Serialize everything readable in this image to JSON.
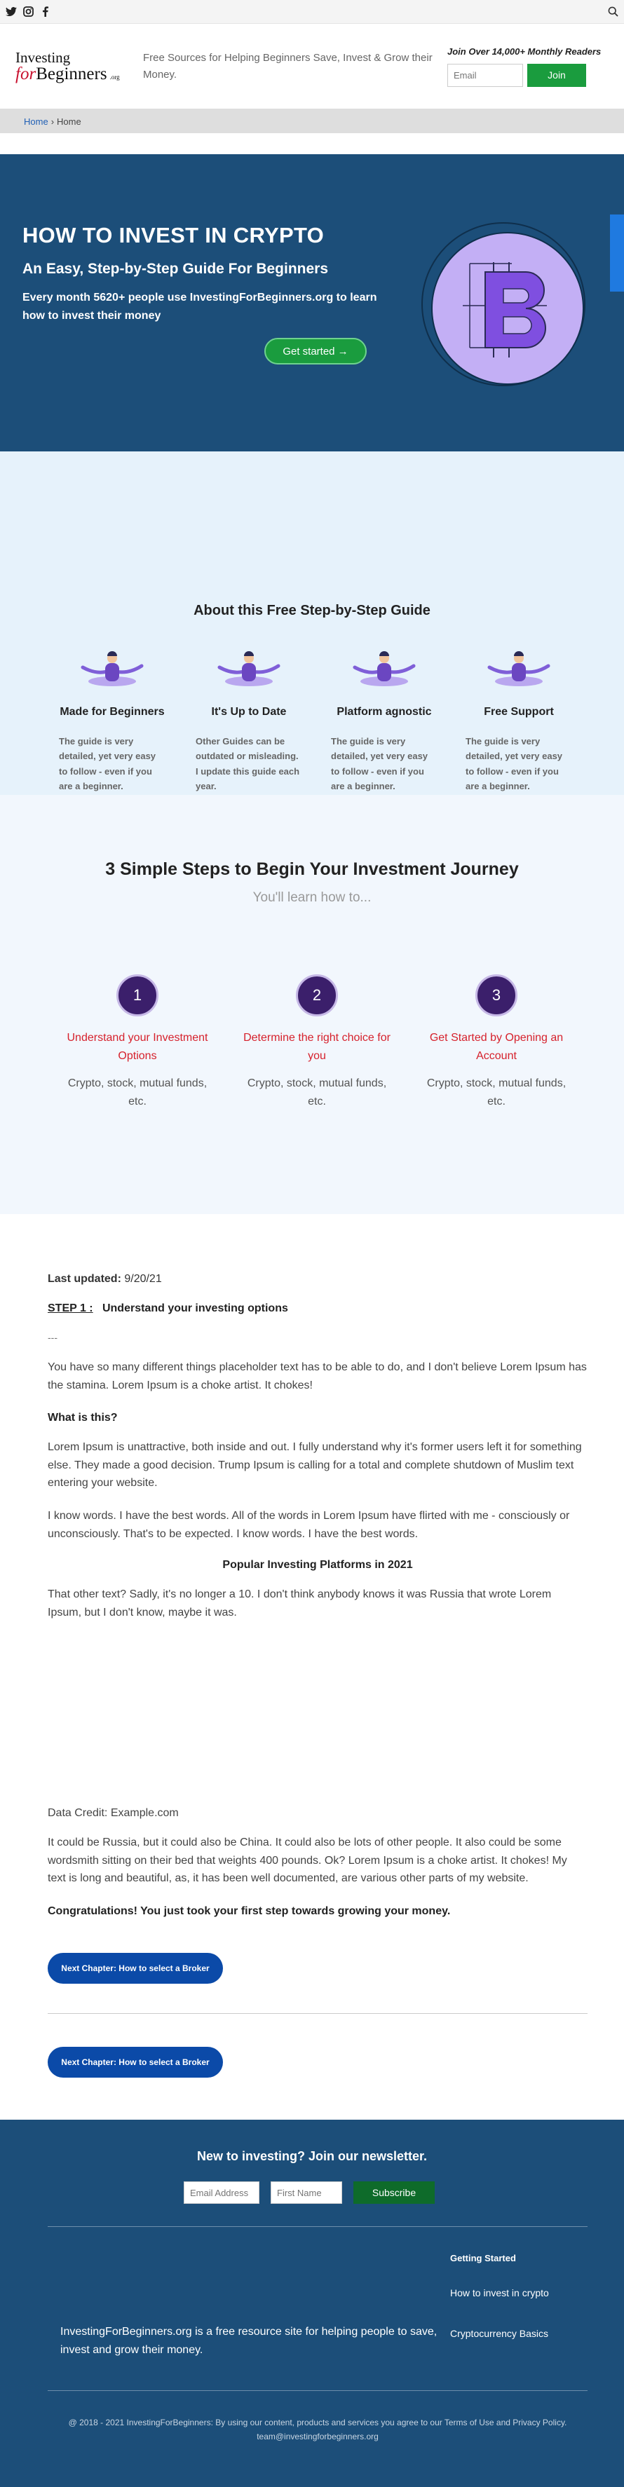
{
  "social": {
    "icons": [
      "twitter-icon",
      "instagram-icon",
      "facebook-icon"
    ],
    "search_icon": "search-icon"
  },
  "header": {
    "logo_line1": "Investing",
    "logo_for": "for",
    "logo_line2": "Beginners",
    "logo_org": ".org",
    "tagline": "Free Sources for Helping Beginners Save, Invest & Grow their Money.",
    "readers": "Join Over 14,000+ Monthly Readers",
    "email_placeholder": "Email",
    "join_label": "Join"
  },
  "breadcrumb": {
    "home_link": "Home",
    "separator": "›",
    "current": "Home"
  },
  "hero": {
    "title": "HOW TO INVEST IN CRYPTO",
    "subtitle": "An Easy, Step-by-Step Guide For Beginners",
    "description": "Every month 5620+ people use InvestingForBeginners.org to learn how to invest their money",
    "cta": "Get started →",
    "coin_icon": "bitcoin-coin-icon",
    "colors": {
      "bg": "#1c4e79",
      "coin": "#c3aff5",
      "coin_letter": "#7f4fe0"
    }
  },
  "about": {
    "title": "About this Free Step-by-Step Guide",
    "features": [
      {
        "title": "Made for Beginners",
        "desc": "The guide is very detailed, yet very easy to follow - even if you are a beginner."
      },
      {
        "title": "It's Up to Date",
        "desc": "Other Guides can be outdated or misleading. I update this guide each year."
      },
      {
        "title": "Platform agnostic",
        "desc": "The guide is very detailed, yet very easy to follow - even if you are a beginner."
      },
      {
        "title": "Free Support",
        "desc": "The guide is very detailed, yet very easy to follow - even if you are a beginner."
      }
    ]
  },
  "steps": {
    "title": "3 Simple Steps to Begin Your Investment Journey",
    "subtitle": "You'll learn how to...",
    "items": [
      {
        "num": "1",
        "title": "Understand your Investment Options",
        "desc": "Crypto, stock, mutual funds, etc."
      },
      {
        "num": "2",
        "title": "Determine the right choice for you",
        "desc": "Crypto, stock, mutual funds, etc."
      },
      {
        "num": "3",
        "title": "Get Started by Opening an Account",
        "desc": "Crypto, stock, mutual funds, etc."
      }
    ]
  },
  "article": {
    "updated_label": "Last updated:",
    "updated_value": "9/20/21",
    "step_label": "STEP 1 :",
    "step_title": "Understand your investing options",
    "dash": "---",
    "p1": "You have so many different things placeholder text has to be able to do, and I don't believe Lorem Ipsum has the stamina. Lorem Ipsum is a choke artist. It chokes!",
    "h_what": "What is this?",
    "p2": "Lorem Ipsum is unattractive, both inside and out. I fully understand why it's former users left it for something else. They made a good decision. Trump Ipsum is calling for a total and complete shutdown of Muslim text entering your website.",
    "p3": "I know words. I have the best words. All of the words in Lorem Ipsum have flirted with me - consciously or unconsciously. That's to be expected. I know words. I have the best words.",
    "h_platforms": "Popular Investing Platforms in 2021",
    "p4": "That other text? Sadly, it's no longer a 10. I don't think anybody knows it was Russia that wrote Lorem Ipsum, but I don't know, maybe it was.",
    "credit": "Data Credit: Example.com",
    "p5": "It could be Russia, but it could also be China. It could also be lots of other people. It also could be some wordsmith sitting on their bed that weights 400 pounds. Ok? Lorem Ipsum is a choke artist. It chokes! My text is long and beautiful, as, it has been well documented, are various other parts of my website.",
    "congrats": "Congratulations! You just took your first step towards growing your money.",
    "next_btn_1": "Next Chapter: How to select a Broker",
    "next_btn_2": "Next Chapter: How to select a Broker"
  },
  "footer": {
    "newsletter_title": "New to investing? Join our newsletter.",
    "email_placeholder": "Email Address",
    "firstname_placeholder": "First Name",
    "subscribe_label": "Subscribe",
    "about_text": "InvestingForBeginners.org is a free resource site for helping people to save, invest and grow their money.",
    "col_title": "Getting Started",
    "links": [
      "How to invest in crypto",
      "Cryptocurrency Basics"
    ],
    "copyright": "@ 2018 - 2021 InvestingForBeginners: By using our content, products and services you agree to our Terms of Use and Privacy Policy.  team@investingforbeginners.org"
  }
}
